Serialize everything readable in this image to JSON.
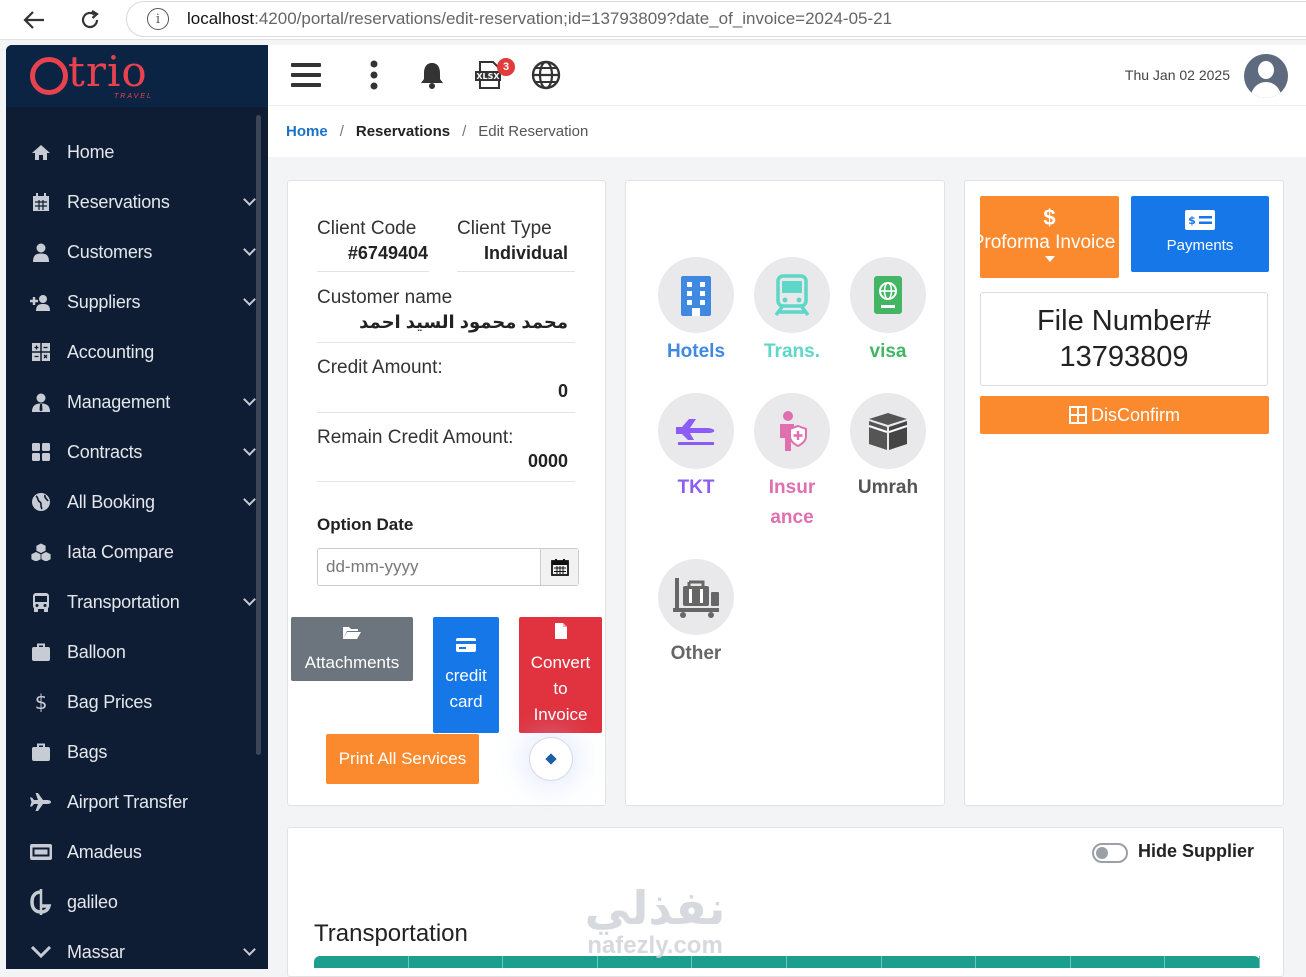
{
  "browser": {
    "url_host": "localhost",
    "url_rest": ":4200/portal/reservations/edit-reservation;id=13793809?date_of_invoice=2024-05-21"
  },
  "brand": {
    "logo_text": "trio",
    "logo_sub": "TRAVEL"
  },
  "sidebar": {
    "items": [
      {
        "label": "Home",
        "icon": "home-icon",
        "has_submenu": false
      },
      {
        "label": "Reservations",
        "icon": "calendar-icon",
        "has_submenu": true
      },
      {
        "label": "Customers",
        "icon": "user-icon",
        "has_submenu": true
      },
      {
        "label": "Suppliers",
        "icon": "user-plus-icon",
        "has_submenu": true
      },
      {
        "label": "Accounting",
        "icon": "calculator-icon",
        "has_submenu": false
      },
      {
        "label": "Management",
        "icon": "user-tie-icon",
        "has_submenu": true
      },
      {
        "label": "Contracts",
        "icon": "grid-icon",
        "has_submenu": true
      },
      {
        "label": "All Booking",
        "icon": "globe-icon",
        "has_submenu": true
      },
      {
        "label": "Iata Compare",
        "icon": "cubes-icon",
        "has_submenu": false
      },
      {
        "label": "Transportation",
        "icon": "bus-icon",
        "has_submenu": true
      },
      {
        "label": "Balloon",
        "icon": "briefcase-icon",
        "has_submenu": false
      },
      {
        "label": "Bag Prices",
        "icon": "dollar-icon",
        "has_submenu": false
      },
      {
        "label": "Bags",
        "icon": "briefcase-icon",
        "has_submenu": false
      },
      {
        "label": "Airport Transfer",
        "icon": "plane-icon",
        "has_submenu": false
      },
      {
        "label": "Amadeus",
        "icon": "window-icon",
        "has_submenu": false
      },
      {
        "label": "galileo",
        "icon": "galileo-icon",
        "has_submenu": false
      },
      {
        "label": "Massar",
        "icon": "chevron-icon",
        "has_submenu": true
      }
    ]
  },
  "topbar": {
    "xlsx_label": "XLSX",
    "xlsx_badge": "3",
    "date": "Thu Jan 02 2025"
  },
  "breadcrumb": {
    "home": "Home",
    "reservations": "Reservations",
    "current": "Edit Reservation",
    "separator": "/"
  },
  "client": {
    "code_label": "Client Code",
    "code_value": "#6749404",
    "type_label": "Client Type",
    "type_value": "Individual",
    "name_label": "Customer name",
    "name_value": "محمد محمود السيد احمد",
    "credit_label": "Credit Amount:",
    "credit_value": "0",
    "remain_label": "Remain Credit Amount:",
    "remain_value": "0000",
    "option_date_label": "Option Date",
    "option_date_placeholder": "dd-mm-yyyy"
  },
  "actions": {
    "attachments": "Attachments",
    "credit_card": "credit card",
    "convert": "Convert to Invoice",
    "print_all": "Print All Services"
  },
  "services": [
    {
      "label": "Hotels",
      "color": "#3f8ae0",
      "icon": "building-icon"
    },
    {
      "label": "Trans.",
      "color": "#5ed6c8",
      "icon": "train-icon"
    },
    {
      "label": "visa",
      "color": "#43b564",
      "icon": "passport-icon"
    },
    {
      "label": "TKT",
      "color": "#8b5cf6",
      "icon": "plane-icon"
    },
    {
      "label": "Insurance",
      "color": "#e06fb0",
      "icon": "insurance-icon"
    },
    {
      "label": "Umrah",
      "color": "#555555",
      "icon": "kaaba-icon"
    },
    {
      "label": "Other",
      "color": "#666666",
      "icon": "luggage-icon"
    }
  ],
  "right": {
    "proforma": "Proforma Invoice",
    "payments": "Payments",
    "file_number_label": "File Number#",
    "file_number": "13793809",
    "disconfirm": "DisConfirm"
  },
  "bottom": {
    "hide_supplier": "Hide Supplier",
    "section_title": "Transportation"
  },
  "watermark": {
    "arabic": "نفذلي",
    "latin": "nafezly.com"
  },
  "colors": {
    "sidebar_bg": "#0e1d33",
    "primary_blue": "#1677e8",
    "orange": "#fb8a2e",
    "red": "#e0333f",
    "gray_btn": "#6c757d",
    "teal": "#1c9e8e"
  }
}
